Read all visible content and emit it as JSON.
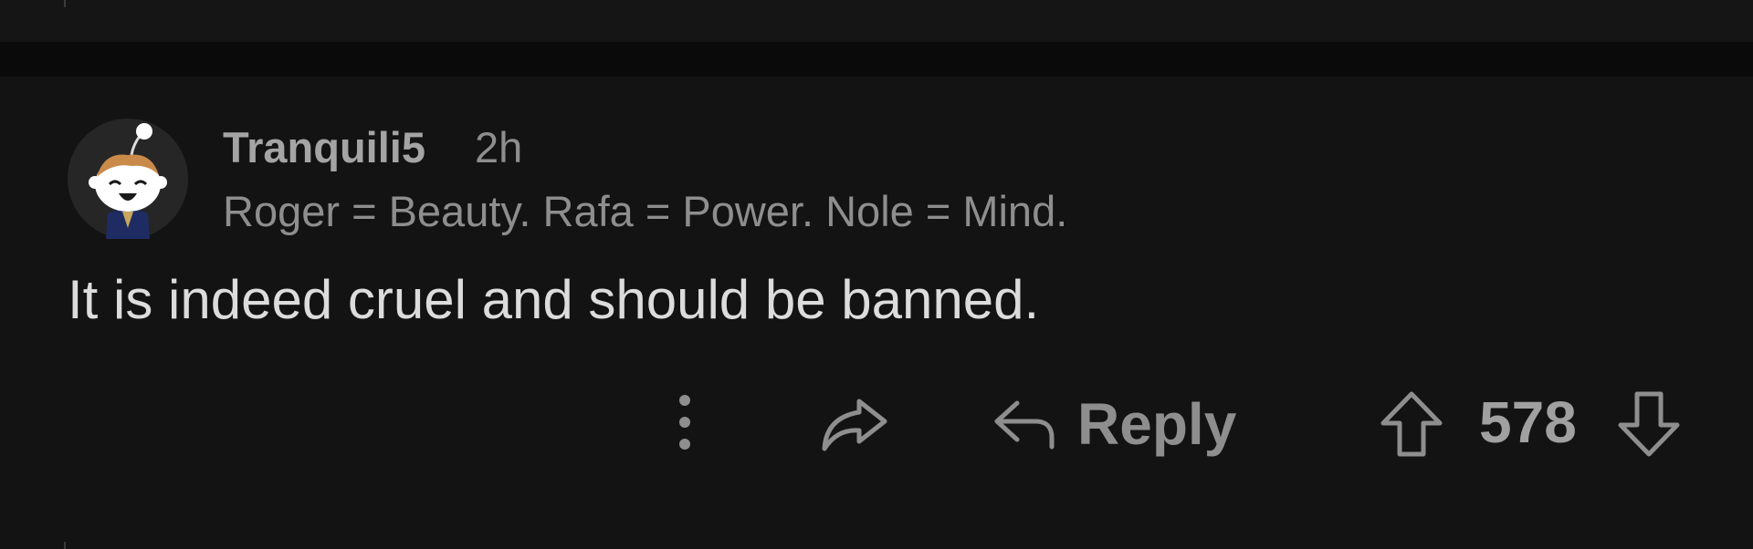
{
  "comment": {
    "author": "Tranquili5",
    "age": "2h",
    "flair": "Roger = Beauty. Rafa = Power. Nole = Mind.",
    "body": "It is indeed cruel and should be banned.",
    "score": "578"
  },
  "actions": {
    "more_icon": "vertical-dots-icon",
    "share_icon": "share-arrow-icon",
    "reply_icon": "reply-arrow-icon",
    "reply_label": "Reply",
    "upvote_icon": "upvote-arrow-icon",
    "downvote_icon": "downvote-arrow-icon"
  },
  "colors": {
    "background": "#131313",
    "divider": "#0a0a0a",
    "text_primary": "#dcdcdc",
    "text_secondary": "#8e8e8e",
    "icon": "#8e8e8e"
  }
}
